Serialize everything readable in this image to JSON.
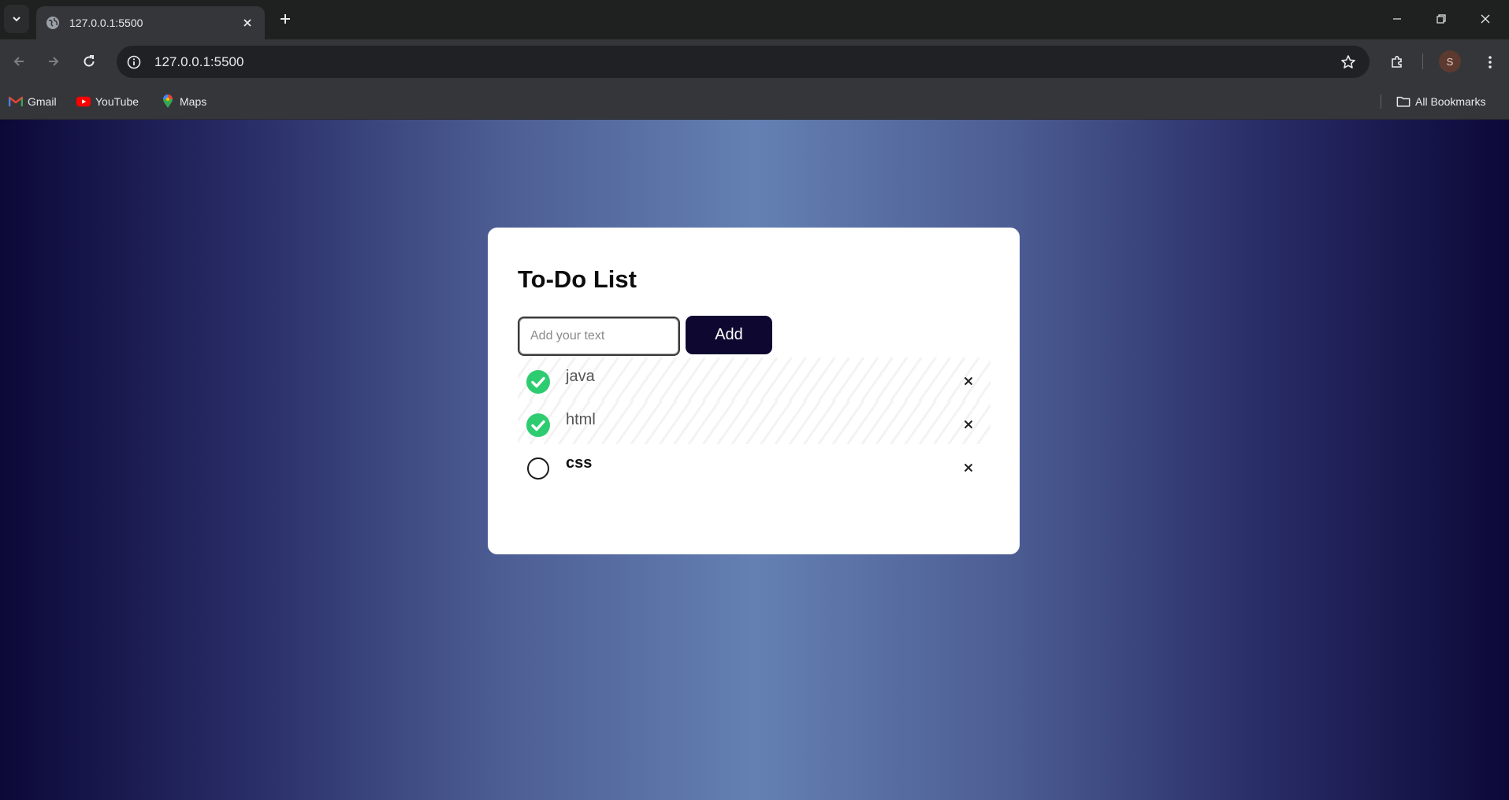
{
  "browser": {
    "tab_title": "127.0.0.1:5500",
    "url": "127.0.0.1:5500",
    "profile_initial": "S",
    "bookmarks": [
      {
        "label": "Gmail",
        "icon": "gmail-icon"
      },
      {
        "label": "YouTube",
        "icon": "youtube-icon"
      },
      {
        "label": "Maps",
        "icon": "maps-icon"
      }
    ],
    "all_bookmarks_label": "All Bookmarks"
  },
  "app": {
    "title": "To-Do List",
    "input": {
      "value": "",
      "placeholder": "Add your text"
    },
    "add_label": "Add",
    "items": [
      {
        "text": "java",
        "checked": true
      },
      {
        "text": "html",
        "checked": true
      },
      {
        "text": "css",
        "checked": false
      }
    ]
  },
  "colors": {
    "check_green": "#2ecc71",
    "add_button_bg": "#0e0830",
    "gradient_edge": "#0c0838",
    "gradient_center": "#6480b3"
  }
}
